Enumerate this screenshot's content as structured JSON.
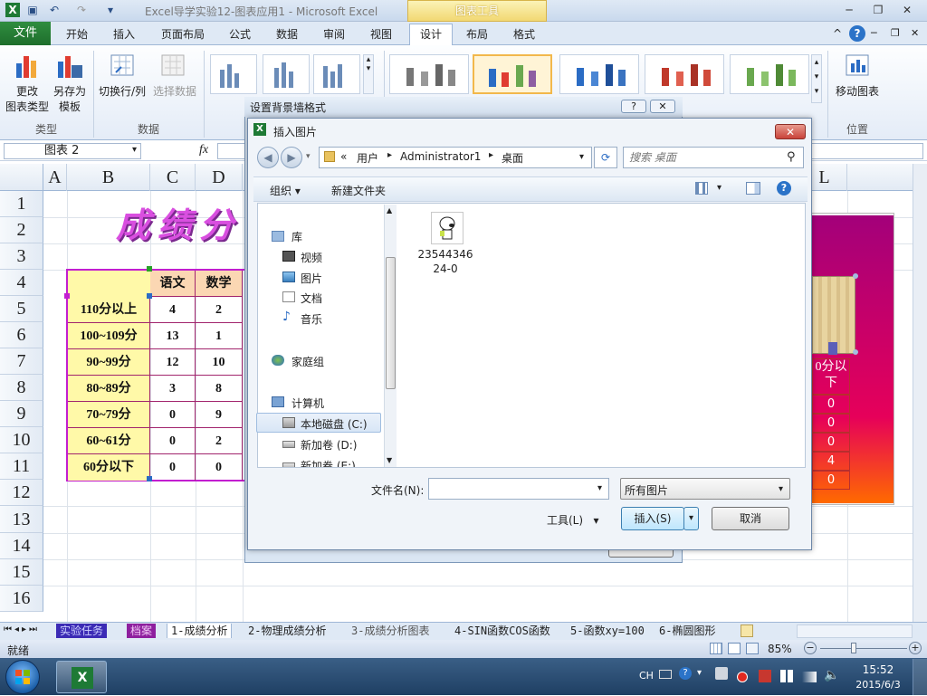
{
  "window": {
    "title": "Excel导学实验12-图表应用1  -  Microsoft Excel",
    "context_tab_group": "图表工具"
  },
  "ribbon": {
    "tabs": [
      "文件",
      "开始",
      "插入",
      "页面布局",
      "公式",
      "数据",
      "审阅",
      "视图",
      "设计",
      "布局",
      "格式"
    ],
    "buttons": {
      "change_chart_type_1": "更改",
      "change_chart_type_2": "图表类型",
      "save_template_1": "另存为",
      "save_template_2": "模板",
      "switch_row_col": "切换行/列",
      "select_data": "选择数据",
      "move_chart": "移动图表"
    },
    "groups": {
      "type": "类型",
      "data": "数据",
      "location": "位置"
    }
  },
  "formula_bar": {
    "name_box": "图表 2",
    "fx": "fx"
  },
  "sheet": {
    "columns": [
      "A",
      "B",
      "C",
      "D",
      "L"
    ],
    "rows": [
      "1",
      "2",
      "3",
      "4",
      "5",
      "6",
      "7",
      "8",
      "9",
      "10",
      "11",
      "12",
      "13",
      "14",
      "15",
      "16"
    ],
    "title_text": "成绩分",
    "table_headers": [
      "语文",
      "数学"
    ],
    "table_rows": [
      {
        "label": "110分以上",
        "c": "4",
        "d": "2"
      },
      {
        "label": "100~109分",
        "c": "13",
        "d": "1"
      },
      {
        "label": "90~99分",
        "c": "12",
        "d": "10"
      },
      {
        "label": "80~89分",
        "c": "3",
        "d": "8"
      },
      {
        "label": "70~79分",
        "c": "0",
        "d": "9"
      },
      {
        "label": "60~61分",
        "c": "0",
        "d": "2"
      },
      {
        "label": "60分以下",
        "c": "0",
        "d": "0"
      }
    ],
    "chart_table_header_1": "0分以",
    "chart_table_header_2": "下",
    "chart_table_values": [
      "0",
      "0",
      "0",
      "4",
      "0"
    ]
  },
  "bg_dialog": {
    "title": "设置背景墙格式"
  },
  "insert_dialog": {
    "title": "插入图片",
    "breadcrumb": [
      "«",
      "用户",
      "Administrator1",
      "桌面"
    ],
    "search_placeholder": "搜索 桌面",
    "organize": "组织",
    "new_folder": "新建文件夹",
    "nav": {
      "library": "库",
      "video": "视频",
      "pictures": "图片",
      "documents": "文档",
      "music": "音乐",
      "homegroup": "家庭组",
      "computer": "计算机",
      "drive_c": "本地磁盘 (C:)",
      "drive_d": "新加卷 (D:)",
      "drive_e": "新加卷 (E:)"
    },
    "file": {
      "name_line1": "23544346",
      "name_line2": "24-0"
    },
    "filename_label": "文件名(N):",
    "filename_value": "",
    "filter": "所有图片",
    "tools": "工具(L)",
    "insert": "插入(S)",
    "cancel": "取消"
  },
  "sheet_tabs": [
    "实验任务",
    "档案",
    "1-成绩分析",
    "2-物理成绩分析",
    "3-成绩分析图表",
    "4-SIN函数COS函数",
    "5-函数xy=100",
    "6-椭圆图形"
  ],
  "status": {
    "ready": "就绪",
    "zoom": "85%"
  },
  "taskbar": {
    "lang": "CH",
    "time": "15:52",
    "date": "2015/6/3"
  }
}
